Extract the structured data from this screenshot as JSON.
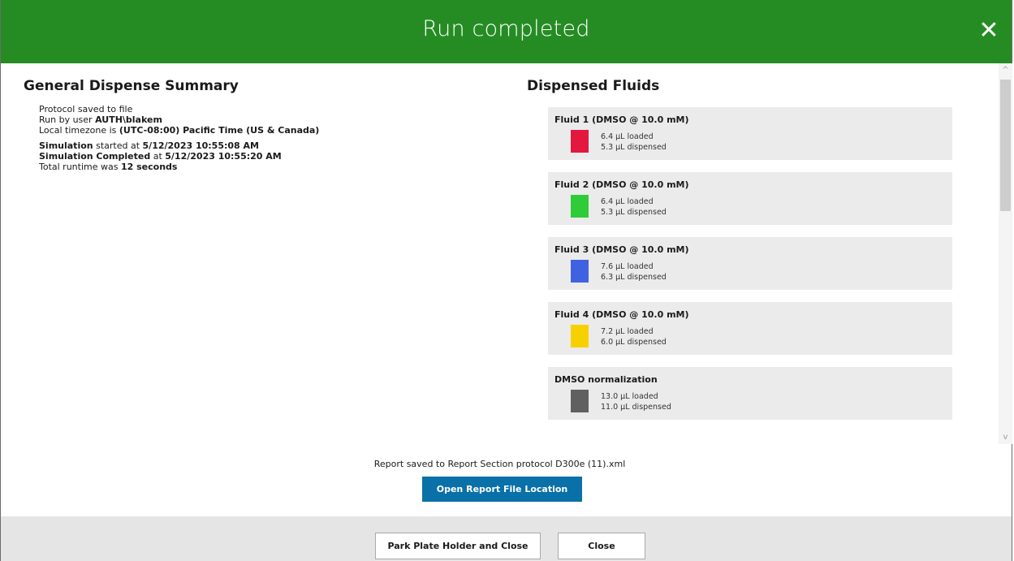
{
  "header": {
    "title": "Run completed",
    "close_glyph": "✕",
    "color": "#258c24"
  },
  "summary": {
    "heading": "General Dispense Summary",
    "line1": "Protocol saved to file",
    "line2_prefix": "Run by user ",
    "line2_user": "AUTH\\blakem",
    "line3_prefix": "Local timezone is ",
    "line3_tz": "(UTC-08:00) Pacific Time (US & Canada)",
    "line4_bold": "Simulation",
    "line4_mid": " started at ",
    "line4_time": "5/12/2023 10:55:08 AM",
    "line5_bold": "Simulation Completed",
    "line5_mid": " at ",
    "line5_time": "5/12/2023 10:55:20 AM",
    "line6_prefix": "Total runtime was ",
    "line6_value": "12 seconds"
  },
  "fluids": {
    "heading": "Dispensed Fluids",
    "items": [
      {
        "name": "Fluid 1 (DMSO @ 10.0 mM)",
        "loaded": "6.4 µL loaded",
        "dispensed": "5.3 µL dispensed",
        "color": "#e3183f"
      },
      {
        "name": "Fluid 2 (DMSO @ 10.0 mM)",
        "loaded": "6.4 µL loaded",
        "dispensed": "5.3 µL dispensed",
        "color": "#2fcc3a"
      },
      {
        "name": "Fluid 3 (DMSO @ 10.0 mM)",
        "loaded": "7.6 µL loaded",
        "dispensed": "6.3 µL dispensed",
        "color": "#3f63e0"
      },
      {
        "name": "Fluid 4 (DMSO @ 10.0 mM)",
        "loaded": "7.2 µL loaded",
        "dispensed": "6.0 µL dispensed",
        "color": "#f7d000"
      },
      {
        "name": "DMSO normalization",
        "loaded": "13.0 µL loaded",
        "dispensed": "11.0 µL dispensed",
        "color": "#606060"
      }
    ]
  },
  "report": {
    "saved_text": "Report saved to Report Section protocol D300e (11).xml",
    "open_button": "Open Report File Location"
  },
  "footer": {
    "park_button": "Park Plate Holder and Close",
    "close_button": "Close"
  },
  "scrollbar": {
    "up": "^",
    "down": "v"
  }
}
